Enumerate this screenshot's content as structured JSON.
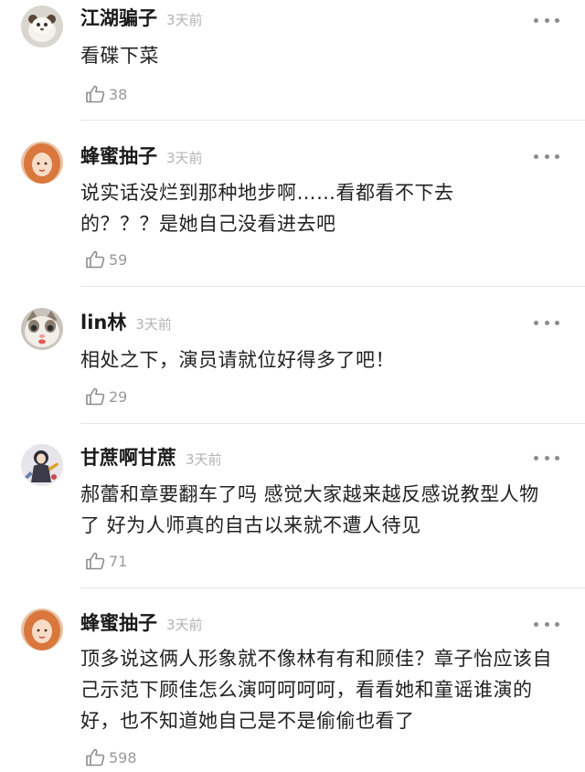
{
  "comments": [
    {
      "username": "江湖骗子",
      "time": "3天前",
      "content": "看碟下菜",
      "likes": "38",
      "avatar_icon": "panda-plush-avatar"
    },
    {
      "username": "蜂蜜抽子",
      "time": "3天前",
      "content": "说实话没烂到那种地步啊……看都看不下去的？？？是她自己没看进去吧",
      "likes": "59",
      "avatar_icon": "girl-orange-hair-avatar"
    },
    {
      "username": "lin林",
      "time": "3天前",
      "content": "相处之下，演员请就位好得多了吧！",
      "likes": "29",
      "avatar_icon": "cat-face-avatar"
    },
    {
      "username": "甘蔗啊甘蔗",
      "time": "3天前",
      "content": "郝蕾和章要翻车了吗 感觉大家越来越反感说教型人物了 好为人师真的自古以来就不遭人待见",
      "likes": "71",
      "avatar_icon": "cartoon-figure-avatar"
    },
    {
      "username": "蜂蜜抽子",
      "time": "3天前",
      "content": "顶多说这俩人形象就不像林有有和顾佳？章子怡应该自己示范下顾佳怎么演呵呵呵呵，看看她和童谣谁演的好，也不知道她自己是不是偷偷也看了",
      "likes": "598",
      "avatar_icon": "girl-orange-hair-avatar"
    }
  ],
  "colors": {
    "text": "#222222",
    "username": "#1a1a1a",
    "meta": "#b3b3b3",
    "like_count": "#9a9a9a",
    "divider": "#e6e6e6",
    "more_dots": "#8c8c8c"
  }
}
